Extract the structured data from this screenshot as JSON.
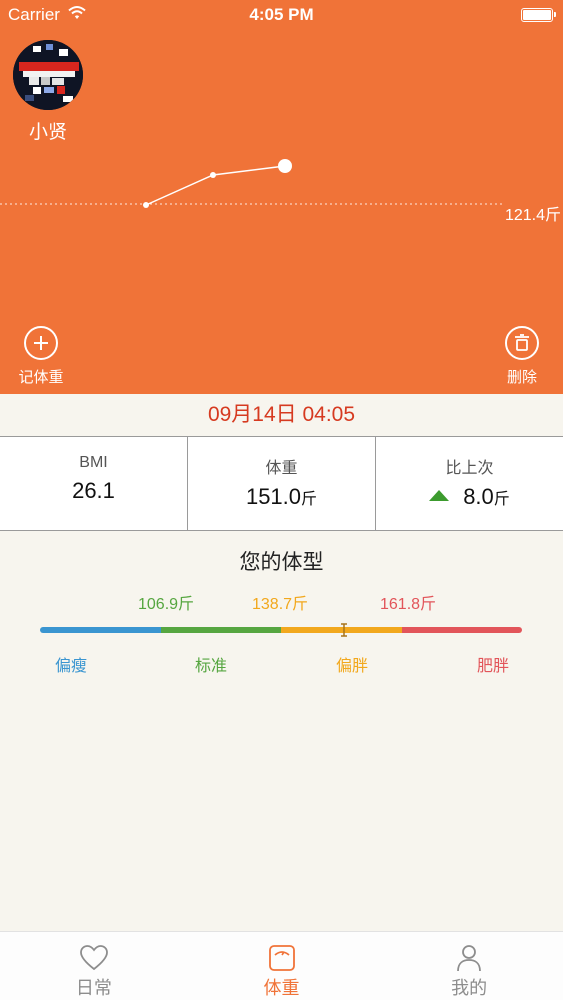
{
  "status_bar": {
    "carrier": "Carrier",
    "time": "4:05 PM"
  },
  "profile": {
    "name": "小贤"
  },
  "trend": {
    "reference_label": "121.4斤"
  },
  "actions": {
    "add_label": "记体重",
    "delete_label": "删除"
  },
  "record": {
    "datetime": "09月14日 04:05"
  },
  "stats": {
    "bmi_label": "BMI",
    "bmi_value": "26.1",
    "weight_label": "体重",
    "weight_value": "151.0",
    "weight_unit": "斤",
    "change_label": "比上次",
    "change_value": "8.0",
    "change_unit": "斤"
  },
  "body_type": {
    "title": "您的体型",
    "thresholds": [
      "106.9斤",
      "138.7斤",
      "161.8斤"
    ],
    "categories": [
      "偏瘦",
      "标准",
      "偏胖",
      "肥胖"
    ],
    "colors": [
      "#3a95d0",
      "#56a640",
      "#f2a81d",
      "#e2555a"
    ]
  },
  "tabs": [
    {
      "label": "日常",
      "icon": "heart-icon"
    },
    {
      "label": "体重",
      "icon": "scale-icon"
    },
    {
      "label": "我的",
      "icon": "person-icon"
    }
  ],
  "colors": {
    "accent": "#f07338",
    "date_text": "#d63a20",
    "increase_arrow": "#3c9b2e"
  }
}
